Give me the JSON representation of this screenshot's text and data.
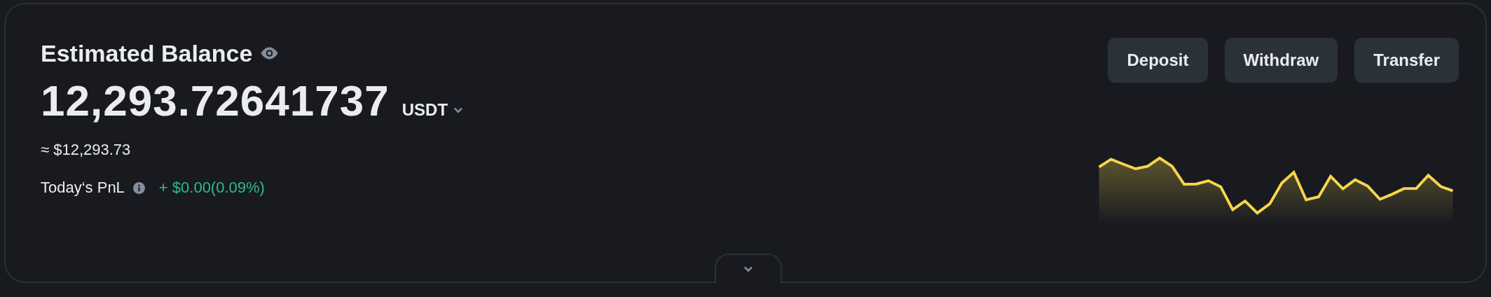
{
  "title": "Estimated Balance",
  "balance": {
    "amount": "12,293.72641737",
    "currency": "USDT"
  },
  "approx_value": "≈ $12,293.73",
  "pnl": {
    "label": "Today‘s PnL",
    "value": "+ $0.00(0.09%)"
  },
  "buttons": [
    "Deposit",
    "Withdraw",
    "Transfer"
  ]
}
